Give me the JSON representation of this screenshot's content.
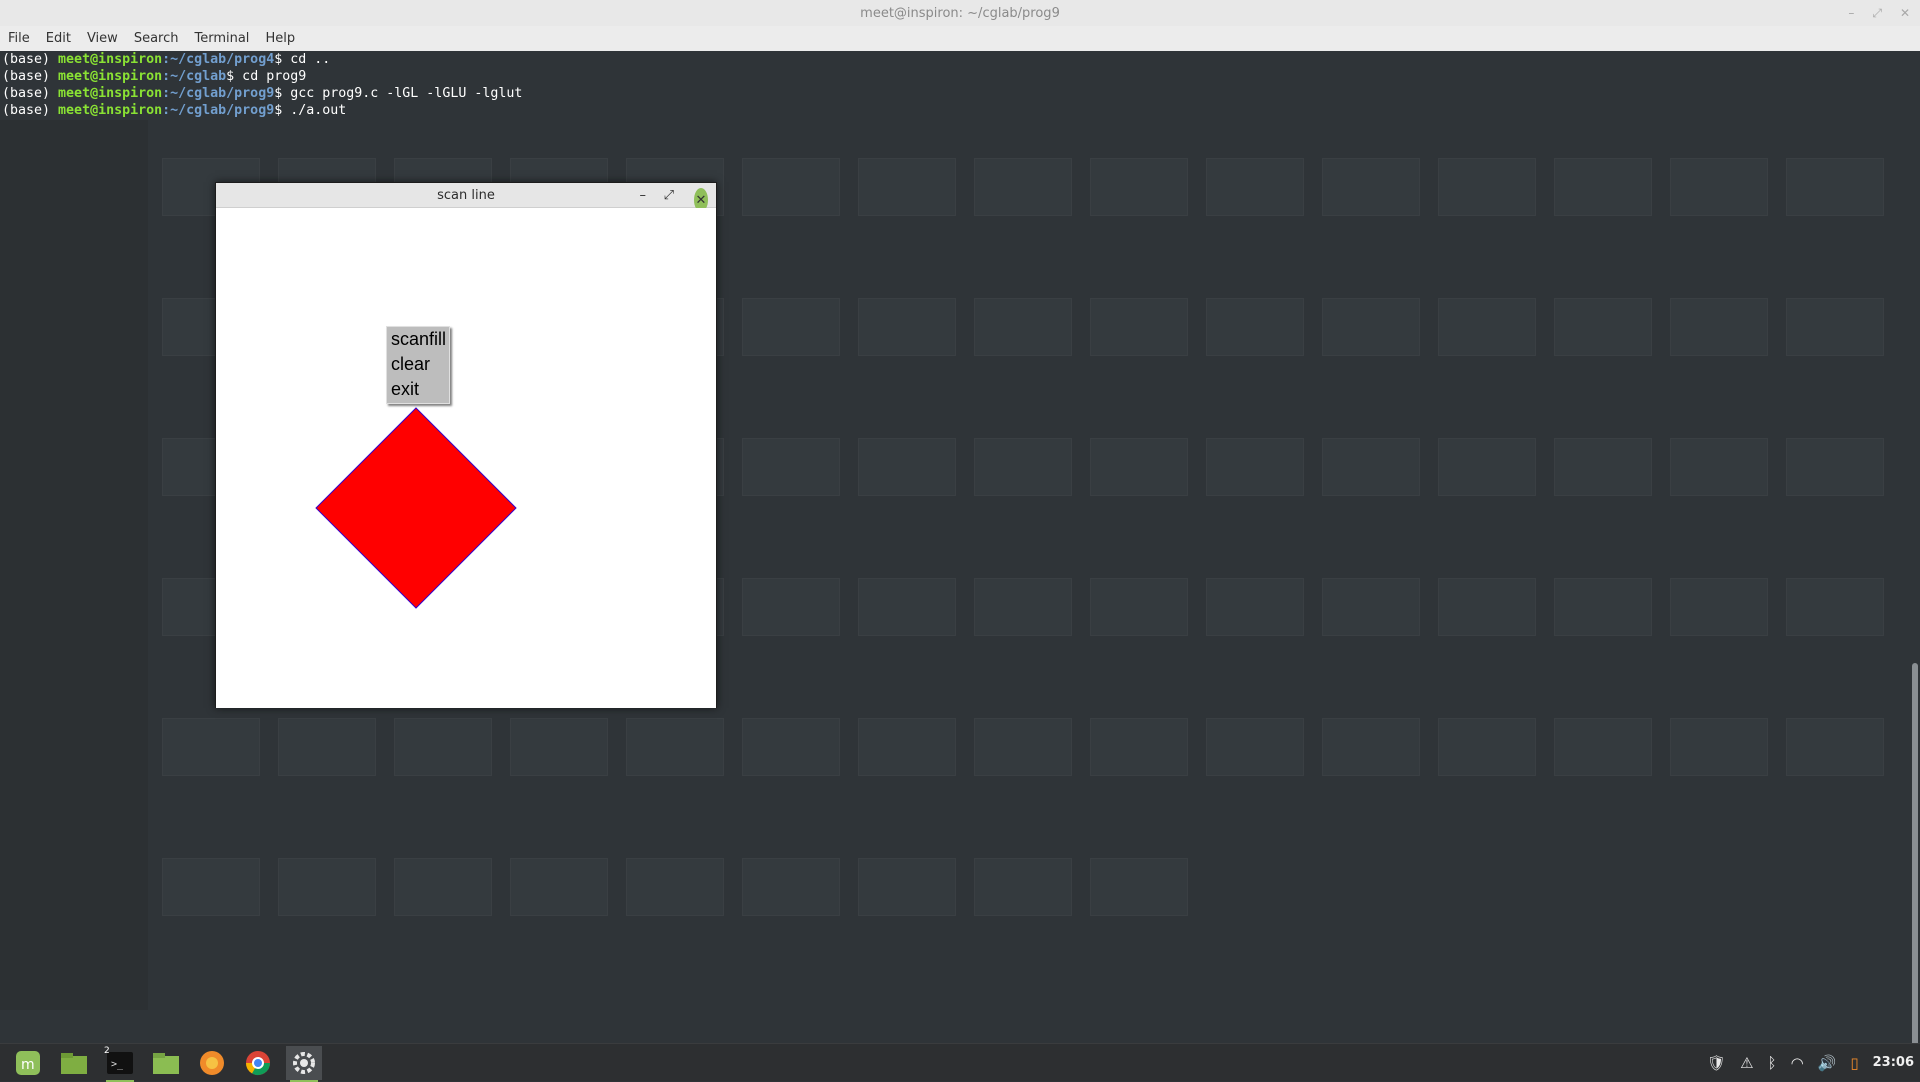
{
  "terminal": {
    "title": "meet@inspiron: ~/cglab/prog9",
    "menu": [
      "File",
      "Edit",
      "View",
      "Search",
      "Terminal",
      "Help"
    ],
    "lines": [
      {
        "prefix": "(base) ",
        "user": "meet@inspiron",
        "path": ":~/cglab/prog4",
        "cmd": "$ cd .."
      },
      {
        "prefix": "(base) ",
        "user": "meet@inspiron",
        "path": ":~/cglab",
        "cmd": "$ cd prog9"
      },
      {
        "prefix": "(base) ",
        "user": "meet@inspiron",
        "path": ":~/cglab/prog9",
        "cmd": "$ gcc prog9.c -lGL -lGLU -lglut"
      },
      {
        "prefix": "(base) ",
        "user": "meet@inspiron",
        "path": ":~/cglab/prog9",
        "cmd": "$ ./a.out"
      }
    ]
  },
  "gl_window": {
    "title": "scan line",
    "minimize_icon": "minimize-icon",
    "maximize_icon": "maximize-icon",
    "close_icon": "close-icon",
    "popup_menu": [
      "scanfill",
      "clear",
      "exit"
    ],
    "shape": {
      "fill": "#ff0000",
      "edge": "#3300cc"
    }
  },
  "taskbar": {
    "apps": [
      "mint-menu-icon",
      "file-manager-icon",
      "terminal-icon",
      "folder-icon",
      "firefox-icon",
      "chrome-icon",
      "settings-icon"
    ],
    "terminal_badge": "2",
    "clock": "23:06",
    "tray_icons": [
      "shield-icon",
      "warning-icon",
      "bluetooth-icon",
      "wifi-icon",
      "volume-icon",
      "notification-icon"
    ]
  },
  "colors": {
    "accent": "#8fbf5a",
    "prompt_user": "#8ae234",
    "prompt_path": "#729fcf"
  }
}
